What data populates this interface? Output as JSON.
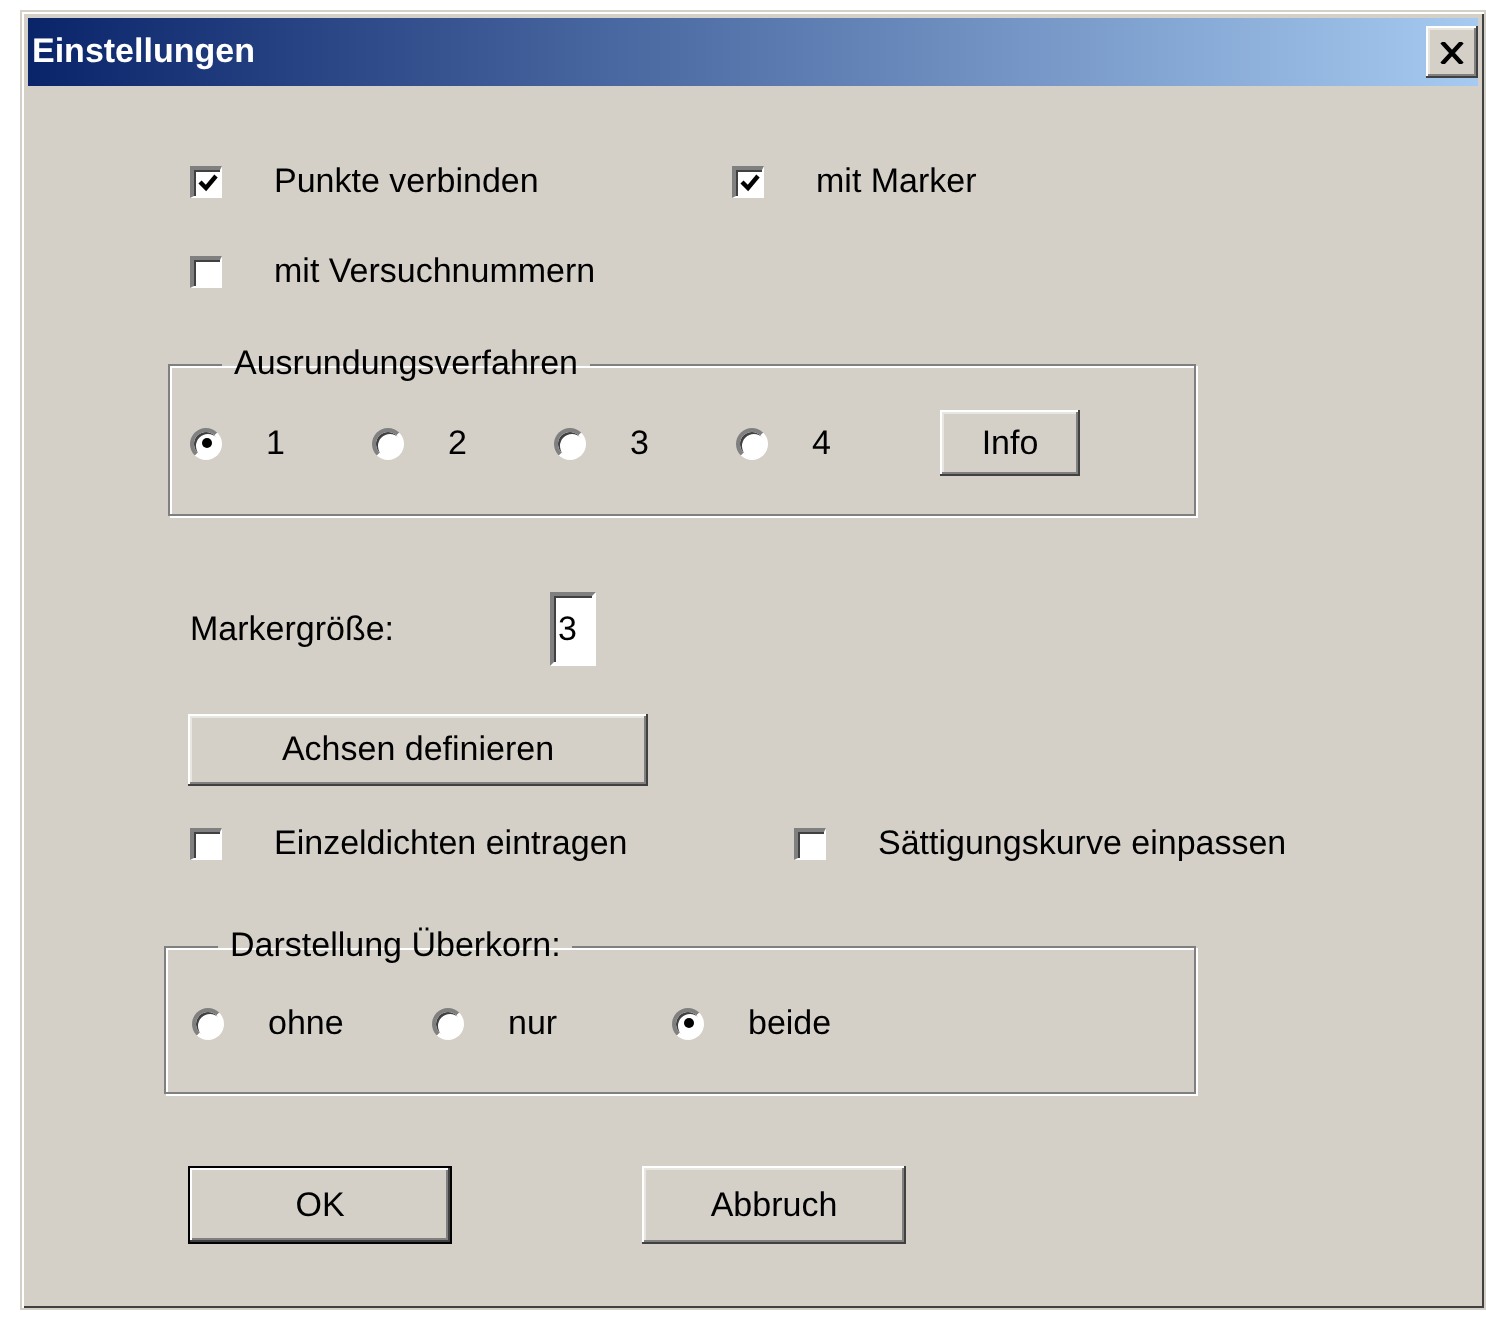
{
  "window": {
    "title": "Einstellungen"
  },
  "options": [
    {
      "label": "Punkte verbinden",
      "checked": true
    },
    {
      "label": "mit Marker",
      "checked": true
    },
    {
      "label": "mit Versuchnummern",
      "checked": false
    }
  ],
  "smoothing": {
    "legend": "Ausrundungsverfahren",
    "options": [
      {
        "label": "1",
        "selected": true
      },
      {
        "label": "2",
        "selected": false
      },
      {
        "label": "3",
        "selected": false
      },
      {
        "label": "4",
        "selected": false
      }
    ],
    "info_button": "Info"
  },
  "marker_size": {
    "label": "Markergröße:",
    "value": "3"
  },
  "axes_button": "Achsen definieren",
  "extras": [
    {
      "label": "Einzeldichten eintragen",
      "checked": false
    },
    {
      "label": "Sättigungskurve einpassen",
      "checked": false
    }
  ],
  "oversize": {
    "legend": "Darstellung Überkorn:",
    "options": [
      {
        "label": "ohne",
        "selected": false
      },
      {
        "label": "nur",
        "selected": false
      },
      {
        "label": "beide",
        "selected": true
      }
    ]
  },
  "buttons": [
    {
      "label": "OK",
      "default": true
    },
    {
      "label": "Abbruch",
      "default": false
    }
  ]
}
